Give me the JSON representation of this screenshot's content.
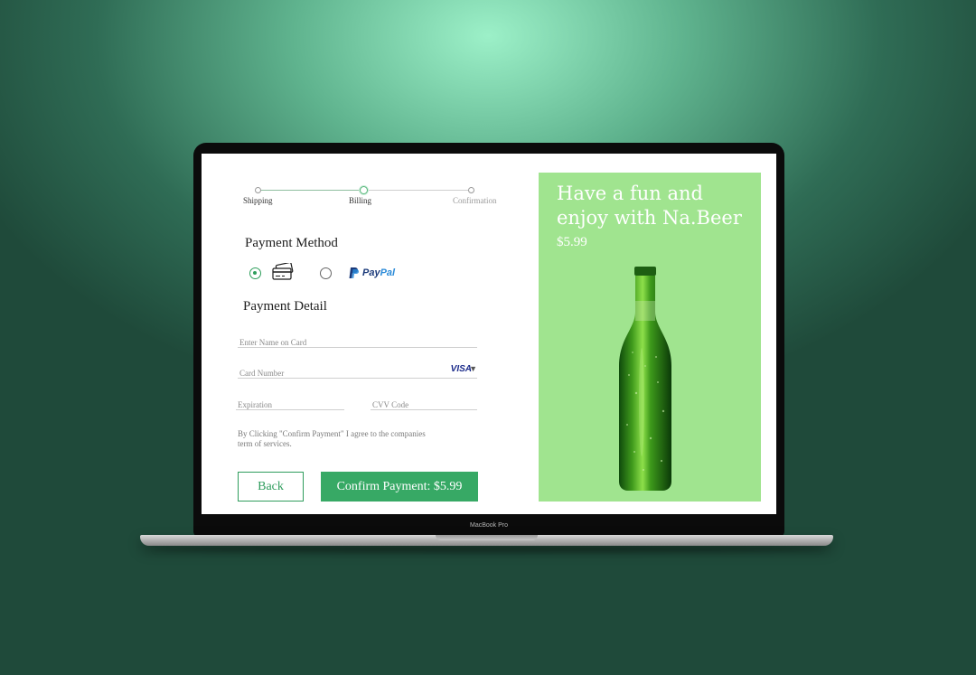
{
  "device": {
    "label": "MacBook Pro"
  },
  "stepper": {
    "steps": [
      {
        "label": "Shipping",
        "state": "done"
      },
      {
        "label": "Billing",
        "state": "active"
      },
      {
        "label": "Confirmation",
        "state": "pending"
      }
    ]
  },
  "payment_method": {
    "title": "Payment Method",
    "options": [
      {
        "name": "credit-card",
        "icon": "credit-card-icon",
        "selected": true
      },
      {
        "name": "paypal",
        "label_part1": "Pay",
        "label_part2": "Pal",
        "selected": false
      }
    ]
  },
  "payment_detail": {
    "title": "Payment Detail",
    "name_on_card": {
      "placeholder": "Enter Name on Card",
      "value": ""
    },
    "card_number": {
      "placeholder": "Card Number",
      "value": "",
      "brand": "VISA",
      "brand_caret": "▼"
    },
    "expiration": {
      "placeholder": "Expiration",
      "value": ""
    },
    "cvv": {
      "placeholder": "CVV Code",
      "value": ""
    }
  },
  "terms_text": "By Clicking \"Confirm Payment\" I agree to the companies term of services.",
  "buttons": {
    "back": "Back",
    "confirm": "Confirm Payment: $5.99"
  },
  "promo": {
    "title": "Have a fun and enjoy with Na.Beer",
    "price": "$5.99",
    "background": "#a0e48f",
    "image": "green-beer-bottle"
  },
  "colors": {
    "accent": "#37a965",
    "accent_dark": "#2f9d5d"
  }
}
